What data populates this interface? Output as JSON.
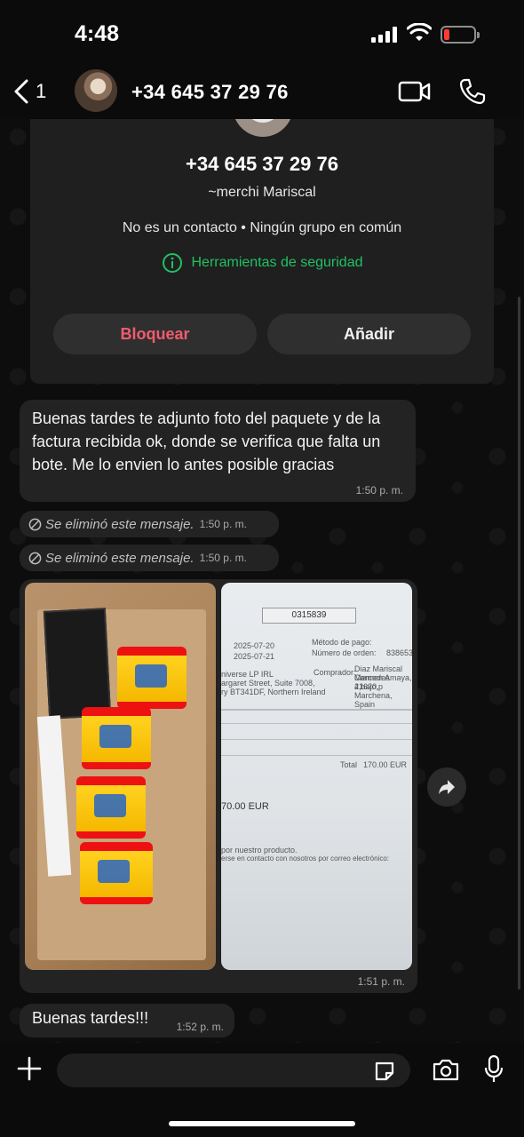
{
  "status_bar": {
    "time": "4:48",
    "battery_level": 0.1,
    "battery_color": "#ff3b30"
  },
  "header": {
    "back_count": "1",
    "contact_name": "+34 645 37 29 76"
  },
  "contact_card": {
    "phone": "+34 645 37 29 76",
    "alias": "~merchi Mariscal",
    "info": "No es un contacto • Ningún grupo en común",
    "security_label": "Herramientas de seguridad",
    "block_label": "Bloquear",
    "add_label": "Añadir"
  },
  "messages": [
    {
      "text": "Buenas tardes te adjunto foto del paquete y de la factura recibida ok, donde se verifica que falta un bote. Me lo envien lo antes posible gracias",
      "time": "1:50 p. m."
    },
    {
      "text": "Se eliminó este mensaje.",
      "time": "1:50 p. m."
    },
    {
      "text": "Se eliminó este mensaje.",
      "time": "1:50 p. m."
    },
    {
      "album": {
        "invoice": {
          "number": "0315839",
          "date1": "2025-07-20",
          "date2": "2025-07-21",
          "payment_method_label": "Método de pago:",
          "order_number_label": "Número de orden:",
          "order_number": "838653",
          "buyer_label": "Comprador:",
          "seller_name": "niverse LP IRL",
          "seller_street": "argaret Street, Suite 7008,",
          "seller_city": "ry BT341DF, Northern Ireland",
          "buyer_name": "Diaz Mariscal Mercedes",
          "buyer_street": "Carmen Amaya, 2,bajo,p",
          "buyer_city": "41620, Marchena, Spain",
          "total_label": "Total",
          "total_value": "170.00 EUR",
          "amount": "70.00 EUR",
          "footer1": "por nuestro producto.",
          "footer2": "erse en contacto con nosotros por correo electrónico:"
        }
      },
      "time": "1:51 p. m."
    },
    {
      "text": "Buenas tardes!!!",
      "time": "1:52 p. m."
    }
  ],
  "composer": {
    "placeholder": ""
  },
  "colors": {
    "accent_green": "#21c063",
    "block_red": "#f15c6d",
    "bubble": "#232323"
  }
}
